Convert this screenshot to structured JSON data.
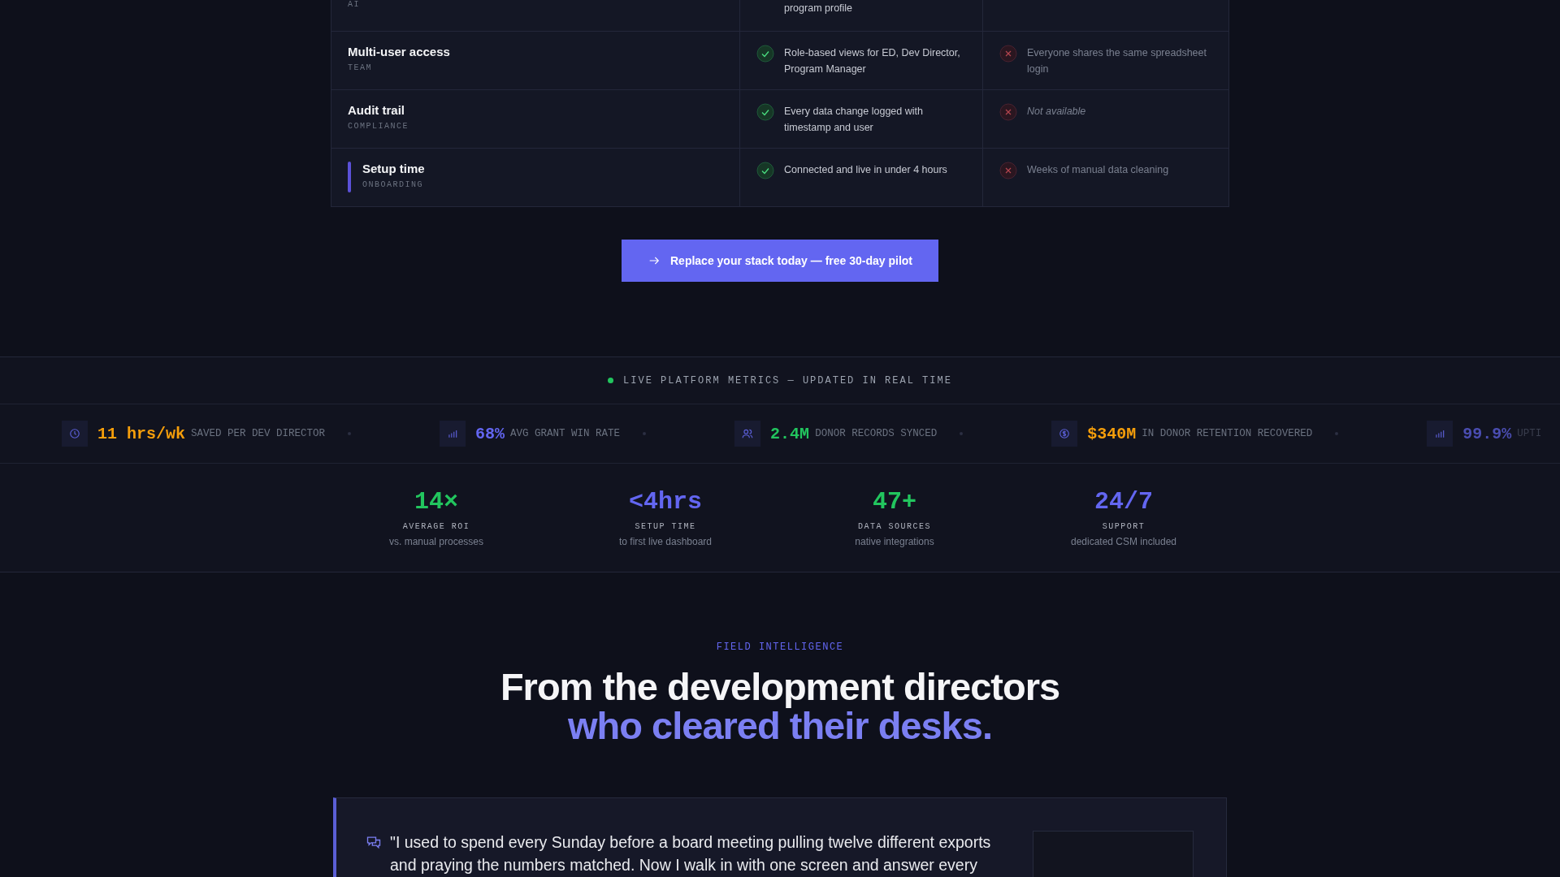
{
  "comparison": {
    "rows": [
      {
        "kind": "partial",
        "tag": "AI",
        "ours": "program profile"
      },
      {
        "kind": "full",
        "title": "Multi-user access",
        "tag": "TEAM",
        "ours": "Role-based views for ED, Dev Director, Program Manager",
        "theirs": "Everyone shares the same spreadsheet login",
        "theirs_italic": false,
        "highlighted": false
      },
      {
        "kind": "full",
        "title": "Audit trail",
        "tag": "COMPLIANCE",
        "ours": "Every data change logged with timestamp and user",
        "theirs": "Not available",
        "theirs_italic": true,
        "highlighted": false
      },
      {
        "kind": "full",
        "title": "Setup time",
        "tag": "ONBOARDING",
        "ours": "Connected and live in under 4 hours",
        "theirs": "Weeks of manual data cleaning",
        "theirs_italic": false,
        "highlighted": true
      }
    ]
  },
  "cta": {
    "label": "Replace your stack today — free 30-day pilot"
  },
  "metrics": {
    "header": "LIVE PLATFORM METRICS — UPDATED IN REAL TIME",
    "ticker": [
      {
        "kind": "clock",
        "value": "11 hrs/wk",
        "label": "SAVED PER DEV DIRECTOR",
        "color": "#f59e0b"
      },
      {
        "kind": "chart",
        "value": "68%",
        "label": "AVG GRANT WIN RATE",
        "color": "#6366f1"
      },
      {
        "kind": "users",
        "value": "2.4M",
        "label": "DONOR RECORDS SYNCED",
        "color": "#22c55e"
      },
      {
        "kind": "dollar",
        "value": "$340M",
        "label": "IN DONOR RETENTION RECOVERED",
        "color": "#f59e0b"
      },
      {
        "kind": "chart",
        "value": "99.9%",
        "label": "UPTI",
        "color": "#4a4db0"
      }
    ],
    "stats": [
      {
        "value": "14×",
        "label": "AVERAGE ROI",
        "sub": "vs. manual processes",
        "color": "#22c55e"
      },
      {
        "value": "<4hrs",
        "label": "SETUP TIME",
        "sub": "to first live dashboard",
        "color": "#6366f1"
      },
      {
        "value": "47+",
        "label": "DATA SOURCES",
        "sub": "native integrations",
        "color": "#22c55e"
      },
      {
        "value": "24/7",
        "label": "SUPPORT",
        "sub": "dedicated CSM included",
        "color": "#6366f1"
      }
    ]
  },
  "testimonials": {
    "eyebrow": "FIELD INTELLIGENCE",
    "headline": "From the development directors",
    "headline_accent": "who cleared their desks.",
    "quote": "\"I used to spend every Sunday before a board meeting pulling twelve different exports and praying the numbers matched. Now I walk in with one screen and answer every"
  }
}
